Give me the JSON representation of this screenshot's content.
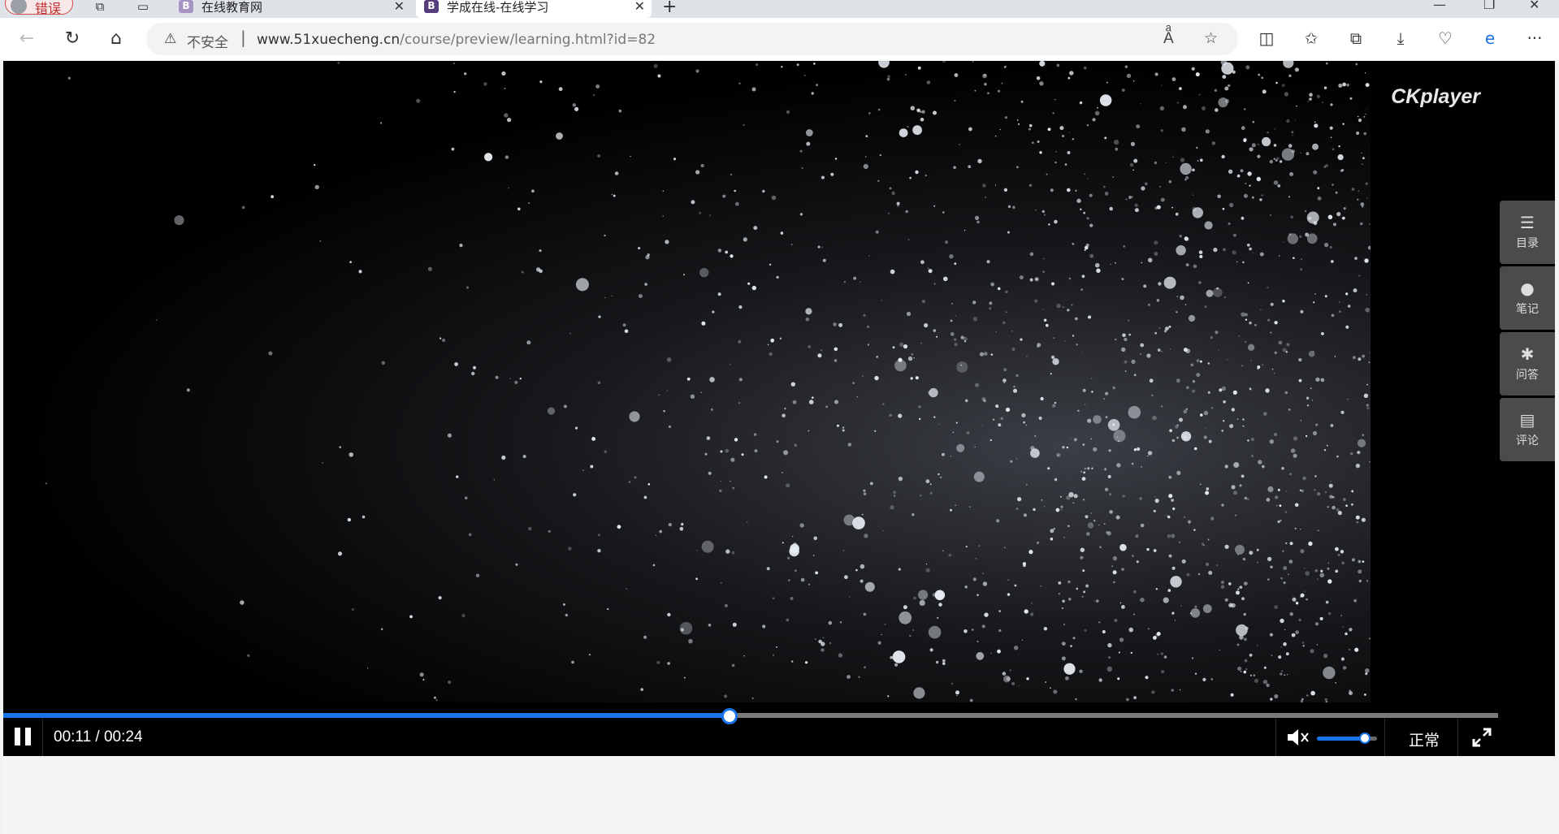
{
  "browser": {
    "profile_label": "错误",
    "tabs": [
      {
        "title": "在线教育网",
        "favicon": "B"
      },
      {
        "title": "学成在线-在线学习",
        "favicon": "B"
      }
    ],
    "address": {
      "security_label": "不安全",
      "url_host": "www.51xuecheng.cn",
      "url_path": "/course/preview/learning.html?id=82"
    },
    "icons": [
      "back-icon",
      "refresh-icon",
      "home-icon",
      "warning-icon",
      "read-aloud-icon",
      "star-icon",
      "split-screen-icon",
      "favorites-icon",
      "collections-icon",
      "download-icon",
      "browser-essentials-icon",
      "edge-icon",
      "more-icon"
    ]
  },
  "player": {
    "logo": "CKplayer",
    "side_menu": [
      {
        "label": "目录",
        "icon": "list-icon"
      },
      {
        "label": "笔记",
        "icon": "user-icon"
      },
      {
        "label": "问答",
        "icon": "gear-icon"
      },
      {
        "label": "评论",
        "icon": "document-icon"
      }
    ],
    "time_display": "00:11 / 00:24",
    "progress_fraction": 0.486,
    "volume_fraction": 0.8,
    "speed_label": "正常",
    "colors": {
      "accent": "#1a73e8",
      "panel": "#4b4b4b"
    }
  }
}
